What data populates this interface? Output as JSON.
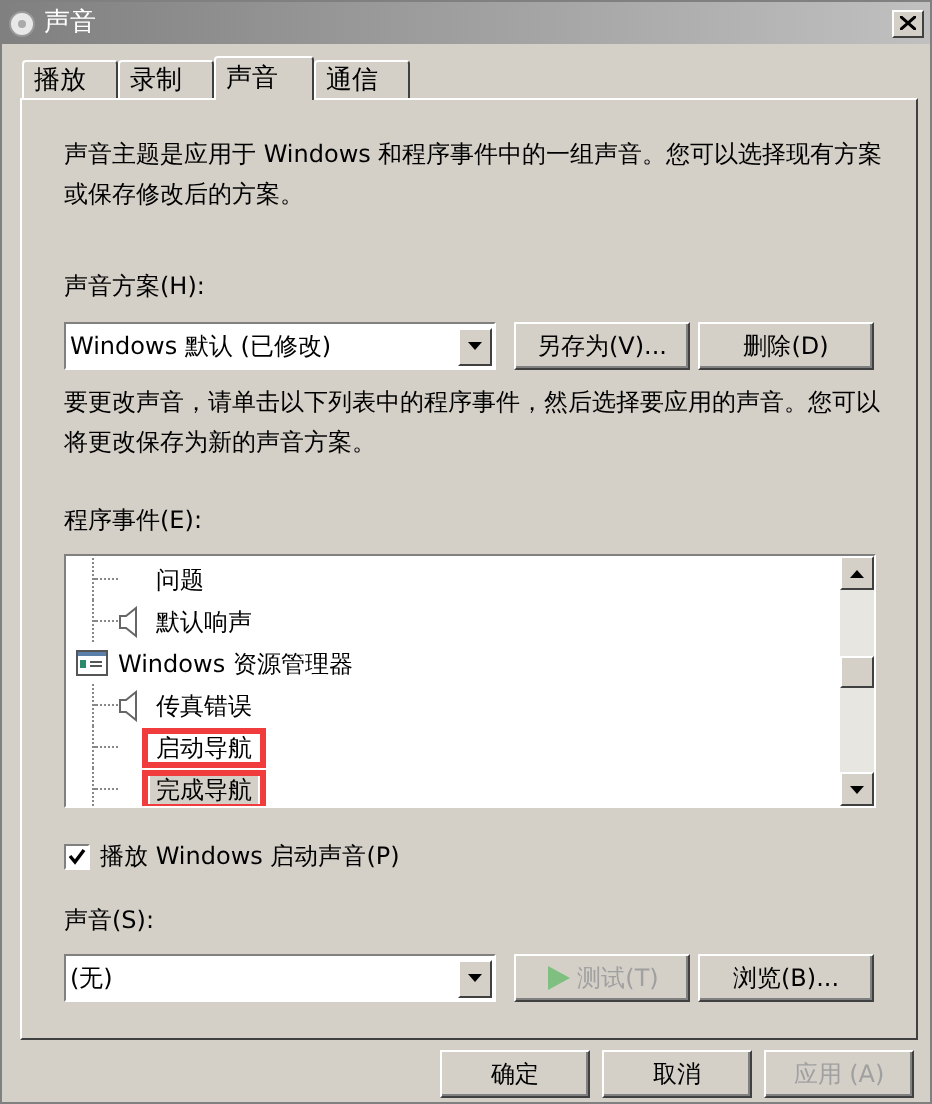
{
  "window": {
    "title": "声音"
  },
  "tabs": [
    {
      "label": "播放",
      "selected": false
    },
    {
      "label": "录制",
      "selected": false
    },
    {
      "label": "声音",
      "selected": true
    },
    {
      "label": "通信",
      "selected": false
    }
  ],
  "intro": "声音主题是应用于 Windows 和程序事件中的一组声音。您可以选择现有方案或保存修改后的方案。",
  "scheme": {
    "label": "声音方案(H):",
    "value": "Windows 默认 (已修改)",
    "buttons": [
      {
        "label": "另存为(V)...",
        "disabled": false
      },
      {
        "label": "删除(D)",
        "disabled": false
      }
    ]
  },
  "instructions": "要更改声音，请单击以下列表中的程序事件，然后选择要应用的声音。您可以将更改保存为新的声音方案。",
  "events": {
    "label": "程序事件(E):",
    "items": [
      {
        "label": "问题",
        "kind": "event",
        "has_sound": false,
        "selected": false,
        "highlighted": false
      },
      {
        "label": "默认响声",
        "kind": "event",
        "has_sound": true,
        "selected": false,
        "highlighted": false
      },
      {
        "label": "Windows 资源管理器",
        "kind": "app",
        "children": [
          {
            "label": "传真错误",
            "has_sound": true,
            "selected": false,
            "highlighted": false
          },
          {
            "label": "启动导航",
            "has_sound": false,
            "selected": false,
            "highlighted": true
          },
          {
            "label": "完成导航",
            "has_sound": false,
            "selected": true,
            "highlighted": true
          }
        ]
      }
    ]
  },
  "startup_sound": {
    "label": "播放 Windows 启动声音(P)",
    "checked": true
  },
  "sound": {
    "label": "声音(S):",
    "value": "(无)",
    "buttons": [
      {
        "label": "测试(T)",
        "kind": "play",
        "disabled": true
      },
      {
        "label": "浏览(B)...",
        "kind": "plain",
        "disabled": false
      }
    ]
  },
  "footer_buttons": [
    {
      "label": "确定",
      "disabled": false
    },
    {
      "label": "取消",
      "disabled": false
    },
    {
      "label": "应用 (A)",
      "disabled": true
    }
  ]
}
